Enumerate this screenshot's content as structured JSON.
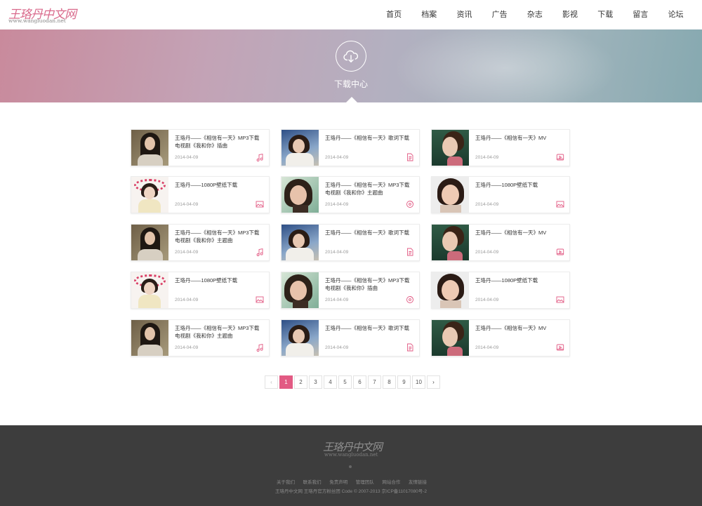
{
  "header": {
    "logo_main": "王珞丹中文网",
    "logo_sub": "www.wangluodan.net",
    "nav": [
      "首页",
      "档案",
      "资讯",
      "广告",
      "杂志",
      "影视",
      "下载",
      "留言",
      "论坛"
    ]
  },
  "banner": {
    "icon": "cloud-download-icon",
    "title": "下载中心"
  },
  "cards": [
    {
      "title": "王珞丹——《相信有一天》MP3下载 电视剧《我和你》插曲",
      "date": "2014-04-09",
      "icon": "music-note-icon",
      "photo": "a"
    },
    {
      "title": "王珞丹——《相信有一天》歌词下载",
      "date": "2014-04-09",
      "icon": "document-icon",
      "photo": "b"
    },
    {
      "title": "王珞丹——《相信有一天》MV",
      "date": "2014-04-09",
      "icon": "video-icon",
      "photo": "c"
    },
    {
      "title": "王珞丹——1080P壁纸下载",
      "date": "2014-04-09",
      "icon": "image-icon",
      "photo": "d"
    },
    {
      "title": "王珞丹——《相信有一天》MP3下载 电视剧《我和你》主题曲",
      "date": "2014-04-09",
      "icon": "vinyl-icon",
      "photo": "e"
    },
    {
      "title": "王珞丹——1080P壁纸下载",
      "date": "2014-04-09",
      "icon": "image-icon",
      "photo": "f"
    },
    {
      "title": "王珞丹——《相信有一天》MP3下载 电视剧《我和你》主题曲",
      "date": "2014-04-09",
      "icon": "music-note-icon",
      "photo": "a"
    },
    {
      "title": "王珞丹——《相信有一天》歌词下载",
      "date": "2014-04-09",
      "icon": "document-icon",
      "photo": "b"
    },
    {
      "title": "王珞丹——《相信有一天》MV",
      "date": "2014-04-09",
      "icon": "video-icon",
      "photo": "c"
    },
    {
      "title": "王珞丹——1080P壁纸下载",
      "date": "2014-04-09",
      "icon": "image-icon",
      "photo": "d"
    },
    {
      "title": "王珞丹——《相信有一天》MP3下载 电视剧《我和你》插曲",
      "date": "2014-04-09",
      "icon": "vinyl-icon",
      "photo": "e"
    },
    {
      "title": "王珞丹——1080P壁纸下载",
      "date": "2014-04-09",
      "icon": "image-icon",
      "photo": "f"
    },
    {
      "title": "王珞丹——《相信有一天》MP3下载 电视剧《我和你》主题曲",
      "date": "2014-04-09",
      "icon": "music-note-icon",
      "photo": "a"
    },
    {
      "title": "王珞丹——《相信有一天》歌词下载",
      "date": "2014-04-09",
      "icon": "document-icon",
      "photo": "b"
    },
    {
      "title": "王珞丹——《相信有一天》MV",
      "date": "2014-04-09",
      "icon": "video-icon",
      "photo": "c"
    }
  ],
  "pagination": {
    "prev": "‹",
    "pages": [
      "1",
      "2",
      "3",
      "4",
      "5",
      "6",
      "7",
      "8",
      "9",
      "10"
    ],
    "current": "1",
    "next": "›"
  },
  "footer": {
    "logo_main": "王珞丹中文网",
    "logo_sub": "www.wangluodan.net",
    "links": [
      "关于我们",
      "联系我们",
      "免责声明",
      "管理团队",
      "网站合作",
      "友情链接"
    ],
    "copyright": "王珞丹中文网 王珞丹官方粉丝团 Code © 2007-2013 京ICP备11017080号-2"
  },
  "colors": {
    "accent": "#e25a83",
    "footer_bg": "#3d3d3d"
  }
}
